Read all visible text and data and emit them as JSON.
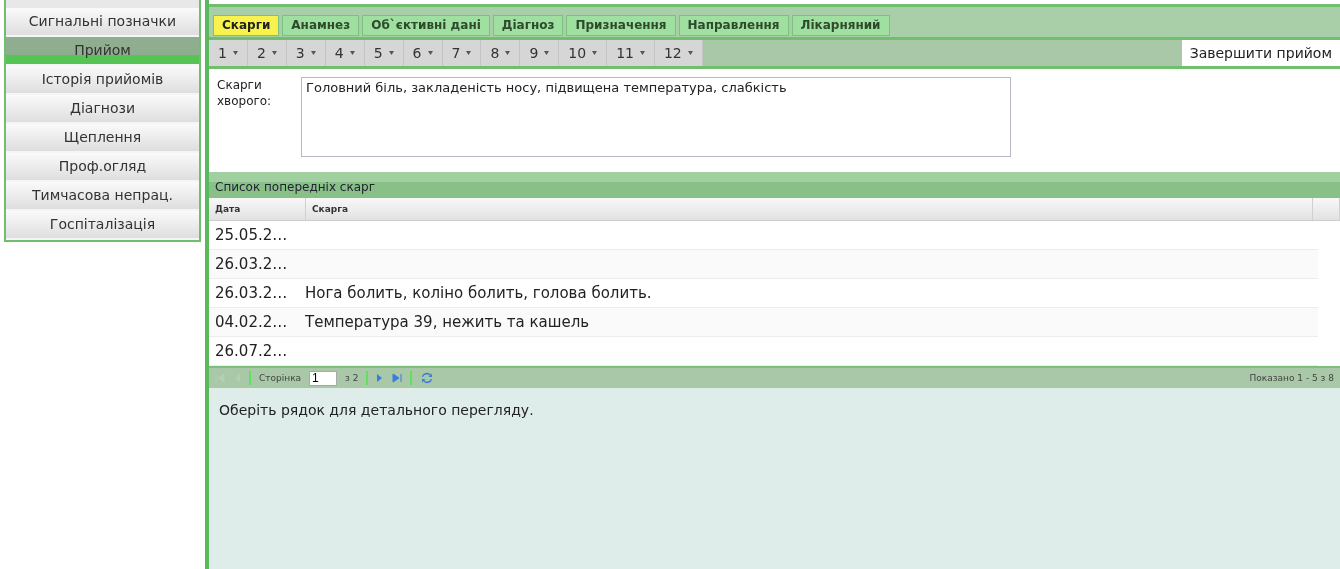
{
  "sidebar": {
    "items": [
      {
        "label": "Сигнальні позначки",
        "selected": false
      },
      {
        "label": "Прийом",
        "selected": true
      },
      {
        "label": "Історія прийомів",
        "selected": false
      },
      {
        "label": "Діагнози",
        "selected": false
      },
      {
        "label": "Щеплення",
        "selected": false
      },
      {
        "label": "Проф.огляд",
        "selected": false
      },
      {
        "label": "Тимчасова непрац.",
        "selected": false
      },
      {
        "label": "Госпіталізація",
        "selected": false
      }
    ]
  },
  "tabs": [
    {
      "label": "Скарги",
      "selected": true
    },
    {
      "label": "Анамнез",
      "selected": false
    },
    {
      "label": "Об`єктивні дані",
      "selected": false
    },
    {
      "label": "Діагноз",
      "selected": false
    },
    {
      "label": "Призначення",
      "selected": false
    },
    {
      "label": "Направлення",
      "selected": false
    },
    {
      "label": "Лікарняний",
      "selected": false
    }
  ],
  "steps": [
    "1",
    "2",
    "3",
    "4",
    "5",
    "6",
    "7",
    "8",
    "9",
    "10",
    "11",
    "12"
  ],
  "finish_button": "Завершити прийом",
  "complaints": {
    "label": "Скарги хворого:",
    "value": "Головний біль, закладеність носу, підвищена температура, слабкість"
  },
  "grid": {
    "title": "Список попередніх скарг",
    "columns": [
      "Дата",
      "Скарга"
    ],
    "rows": [
      {
        "date": "25.05.2…",
        "complaint": ""
      },
      {
        "date": "26.03.2…",
        "complaint": ""
      },
      {
        "date": "26.03.2…",
        "complaint": "Нога болить, коліно болить, голова болить."
      },
      {
        "date": "04.02.2…",
        "complaint": "Температура 39, нежить та кашель"
      },
      {
        "date": "26.07.2…",
        "complaint": ""
      }
    ]
  },
  "pager": {
    "page_label": "Сторінка",
    "page": "1",
    "of": "з 2",
    "summary": "Показано 1 - 5 з 8"
  },
  "detail": "Оберіть рядок для детального перегляду."
}
